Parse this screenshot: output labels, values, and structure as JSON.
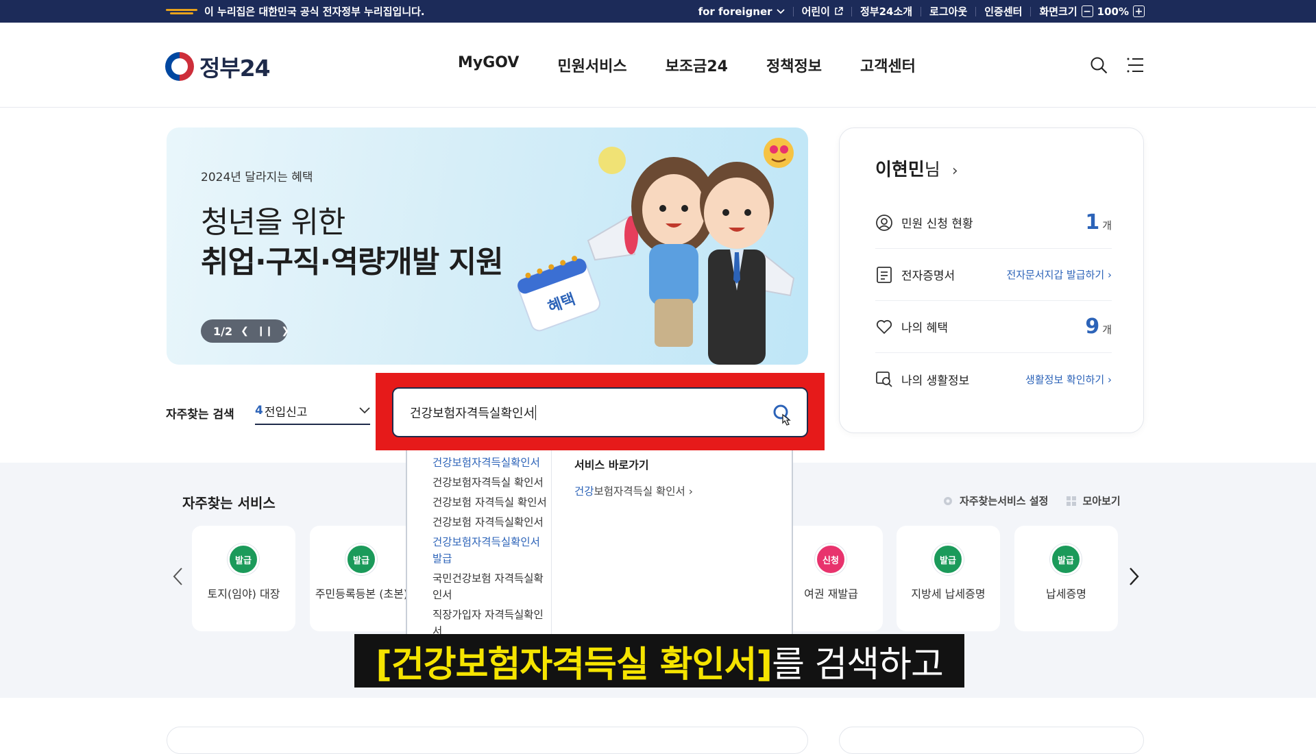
{
  "topbar": {
    "notice": "이 누리집은 대한민국 공식 전자정부 누리집입니다.",
    "utils": [
      "for foreigner",
      "어린이",
      "정부24소개",
      "로그아웃",
      "인증센터",
      "화면크기"
    ],
    "zoom": "100%"
  },
  "header": {
    "logo": "정부24",
    "nav": [
      "MyGOV",
      "민원서비스",
      "보조금24",
      "정책정보",
      "고객센터"
    ]
  },
  "banner": {
    "sub": "2024년 달라지는 혜택",
    "title1": "청년을 위한",
    "title2": "취업·구직·역량개발 지원",
    "pager": "1/2",
    "calendar_text": "혜택"
  },
  "user": {
    "name": "이현민",
    "suffix": "님",
    "rows": [
      {
        "label": "민원 신청 현황",
        "value": "1",
        "unit": "개"
      },
      {
        "label": "전자증명서",
        "link": "전자문서지갑 발급하기"
      },
      {
        "label": "나의 혜택",
        "value": "9",
        "unit": "개"
      },
      {
        "label": "나의 생활정보",
        "link": "생활정보 확인하기"
      }
    ]
  },
  "search": {
    "freq_label": "자주찾는 검색",
    "freq_num": "4",
    "freq_value": "전입신고",
    "query": "건강보험자격득실확인서"
  },
  "autocomplete": {
    "suggestions": [
      "건강보험자격득실확인서",
      "건강보험자격득실 확인서",
      "건강보험 자격득실 확인서",
      "건강보험 자격득실확인서",
      "건강보험자격득실확인서 발급",
      "국민건강보험 자격득실확인서",
      "직장가입자 자격득실확인서"
    ],
    "shortcut_title": "서비스 바로가기",
    "shortcut_prefix": "건강",
    "shortcut_rest": "보험자격득실 확인서"
  },
  "frequent": {
    "title": "자주찾는 서비스",
    "settings": "자주찾는서비스 설정",
    "view_all": "모아보기",
    "cards": [
      {
        "badge": "발급",
        "label": "토지(임야) 대장"
      },
      {
        "badge": "발급",
        "label": "주민등록등본 (초본)"
      },
      {
        "badge": "신청",
        "label": "여권 재발급"
      },
      {
        "badge": "발급",
        "label": "지방세 납세증명"
      },
      {
        "badge": "발급",
        "label": "납세증명"
      }
    ]
  },
  "caption": {
    "highlight": "[건강보험자격득실 확인서]",
    "rest": "를 검색하고"
  },
  "colors": {
    "navy": "#1c2b59",
    "blue": "#2c63b8",
    "red_box": "#e61a1a",
    "green_badge": "#1b9a5a",
    "pink_badge": "#e8336d",
    "caption_yellow": "#f5e400"
  }
}
